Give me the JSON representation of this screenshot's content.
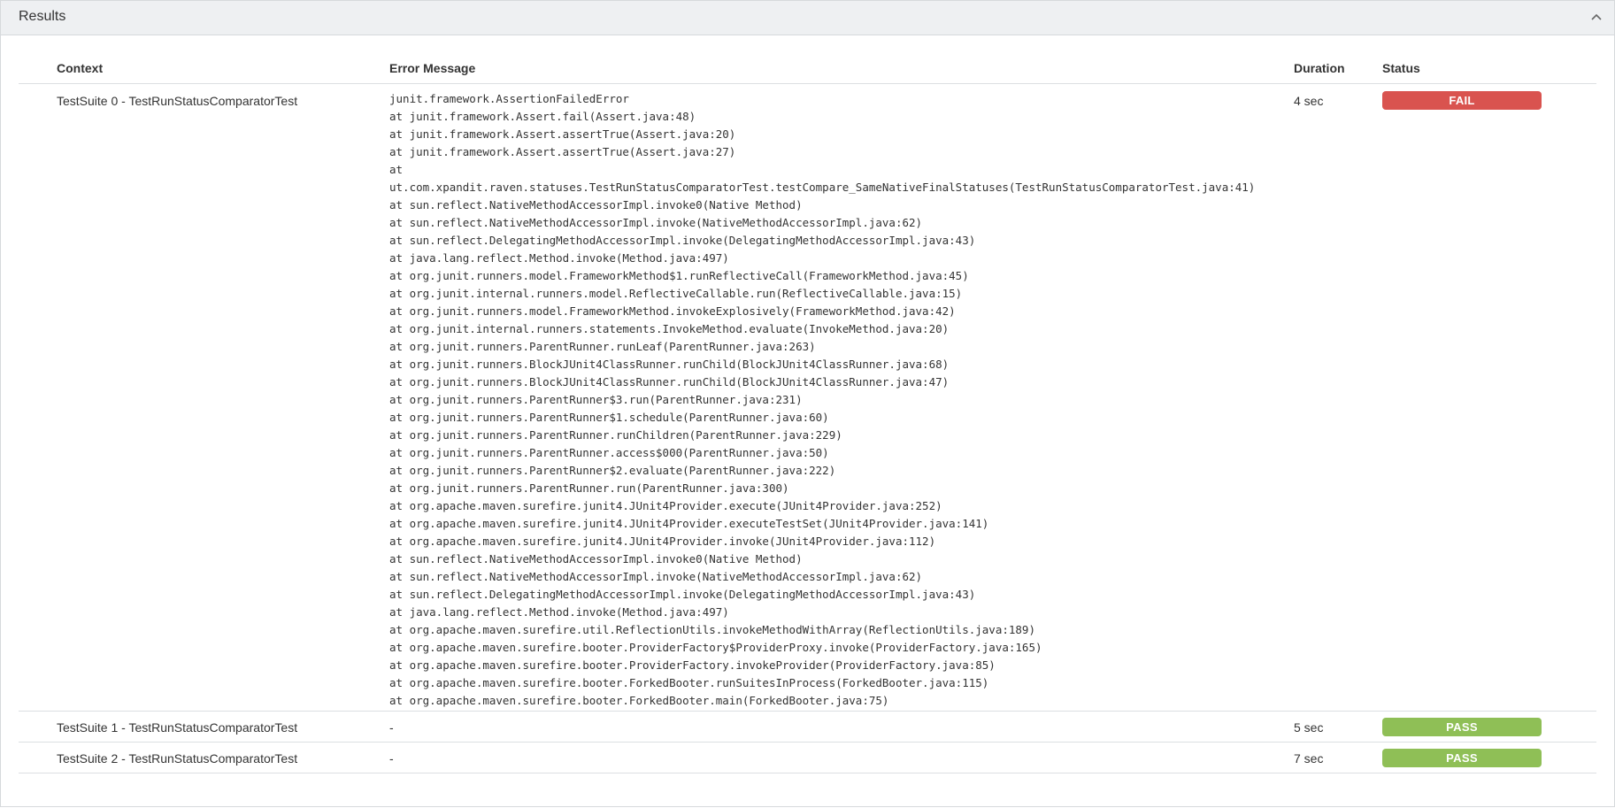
{
  "panel": {
    "title": "Results",
    "collapse_icon": "chevron-up-icon"
  },
  "table": {
    "headers": {
      "context": "Context",
      "error": "Error Message",
      "duration": "Duration",
      "status": "Status"
    },
    "rows": [
      {
        "context": "TestSuite 0 - TestRunStatusComparatorTest",
        "error": "junit.framework.AssertionFailedError\nat junit.framework.Assert.fail(Assert.java:48)\nat junit.framework.Assert.assertTrue(Assert.java:20)\nat junit.framework.Assert.assertTrue(Assert.java:27)\nat\nut.com.xpandit.raven.statuses.TestRunStatusComparatorTest.testCompare_SameNativeFinalStatuses(TestRunStatusComparatorTest.java:41)\nat sun.reflect.NativeMethodAccessorImpl.invoke0(Native Method)\nat sun.reflect.NativeMethodAccessorImpl.invoke(NativeMethodAccessorImpl.java:62)\nat sun.reflect.DelegatingMethodAccessorImpl.invoke(DelegatingMethodAccessorImpl.java:43)\nat java.lang.reflect.Method.invoke(Method.java:497)\nat org.junit.runners.model.FrameworkMethod$1.runReflectiveCall(FrameworkMethod.java:45)\nat org.junit.internal.runners.model.ReflectiveCallable.run(ReflectiveCallable.java:15)\nat org.junit.runners.model.FrameworkMethod.invokeExplosively(FrameworkMethod.java:42)\nat org.junit.internal.runners.statements.InvokeMethod.evaluate(InvokeMethod.java:20)\nat org.junit.runners.ParentRunner.runLeaf(ParentRunner.java:263)\nat org.junit.runners.BlockJUnit4ClassRunner.runChild(BlockJUnit4ClassRunner.java:68)\nat org.junit.runners.BlockJUnit4ClassRunner.runChild(BlockJUnit4ClassRunner.java:47)\nat org.junit.runners.ParentRunner$3.run(ParentRunner.java:231)\nat org.junit.runners.ParentRunner$1.schedule(ParentRunner.java:60)\nat org.junit.runners.ParentRunner.runChildren(ParentRunner.java:229)\nat org.junit.runners.ParentRunner.access$000(ParentRunner.java:50)\nat org.junit.runners.ParentRunner$2.evaluate(ParentRunner.java:222)\nat org.junit.runners.ParentRunner.run(ParentRunner.java:300)\nat org.apache.maven.surefire.junit4.JUnit4Provider.execute(JUnit4Provider.java:252)\nat org.apache.maven.surefire.junit4.JUnit4Provider.executeTestSet(JUnit4Provider.java:141)\nat org.apache.maven.surefire.junit4.JUnit4Provider.invoke(JUnit4Provider.java:112)\nat sun.reflect.NativeMethodAccessorImpl.invoke0(Native Method)\nat sun.reflect.NativeMethodAccessorImpl.invoke(NativeMethodAccessorImpl.java:62)\nat sun.reflect.DelegatingMethodAccessorImpl.invoke(DelegatingMethodAccessorImpl.java:43)\nat java.lang.reflect.Method.invoke(Method.java:497)\nat org.apache.maven.surefire.util.ReflectionUtils.invokeMethodWithArray(ReflectionUtils.java:189)\nat org.apache.maven.surefire.booter.ProviderFactory$ProviderProxy.invoke(ProviderFactory.java:165)\nat org.apache.maven.surefire.booter.ProviderFactory.invokeProvider(ProviderFactory.java:85)\nat org.apache.maven.surefire.booter.ForkedBooter.runSuitesInProcess(ForkedBooter.java:115)\nat org.apache.maven.surefire.booter.ForkedBooter.main(ForkedBooter.java:75)",
        "duration": "4 sec",
        "status": "FAIL"
      },
      {
        "context": "TestSuite 1 - TestRunStatusComparatorTest",
        "error": "-",
        "duration": "5 sec",
        "status": "PASS"
      },
      {
        "context": "TestSuite 2 - TestRunStatusComparatorTest",
        "error": "-",
        "duration": "7 sec",
        "status": "PASS"
      }
    ]
  },
  "colors": {
    "fail": "#d9534f",
    "pass": "#8fbf56",
    "header_bg": "#eef0f2"
  }
}
